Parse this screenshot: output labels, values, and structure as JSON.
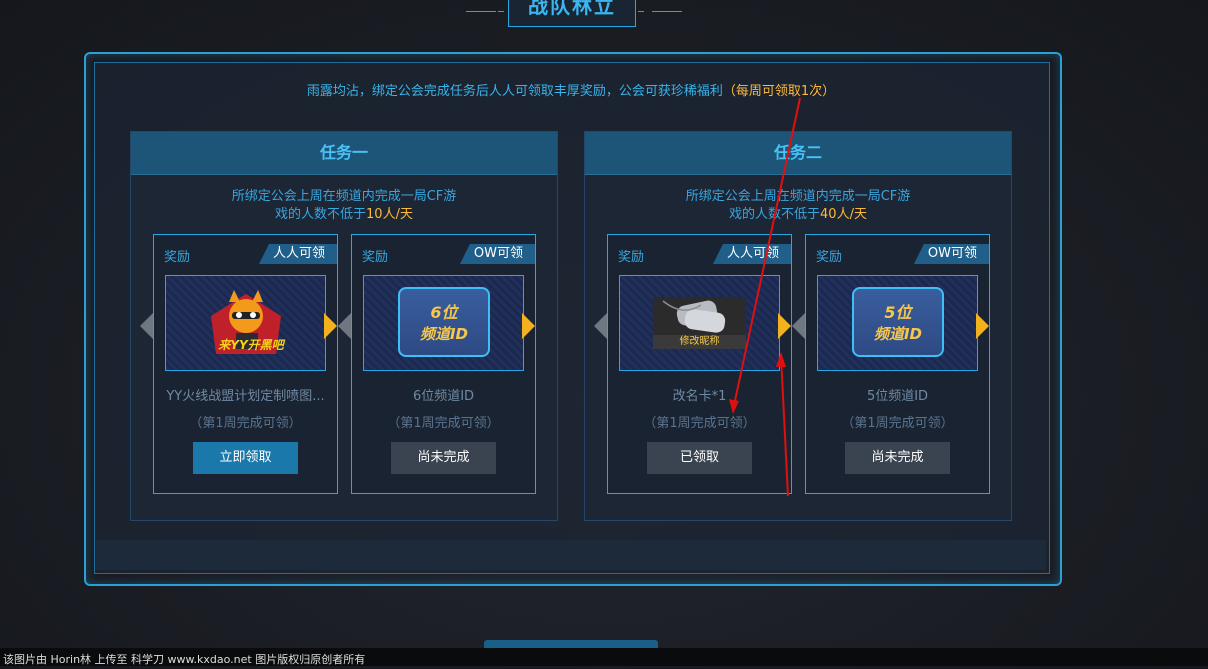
{
  "header": {
    "title": "战队林立"
  },
  "intro": {
    "text": "雨露均沾，绑定公会完成任务后人人可领取丰厚奖励，公会可获珍稀福利",
    "highlight": "（每周可领取1次）"
  },
  "tasks": [
    {
      "title": "任务一",
      "desc_line1": "所绑定公会上周在频道内完成一局CF游",
      "desc_line2": "戏的人数不低于",
      "desc_highlight": "10人/天",
      "cards": [
        {
          "label": "奖励",
          "badge": "人人可领",
          "name": "YY火线战盟计划定制喷图...",
          "art_text": "来YY开黑吧",
          "week": "（第1周完成可领）",
          "button": "立即领取"
        },
        {
          "label": "奖励",
          "badge": "OW可领",
          "name": "6位频道ID",
          "id_l1": "6位",
          "id_l2": "频道ID",
          "week": "（第1周完成可领）",
          "button": "尚未完成"
        }
      ]
    },
    {
      "title": "任务二",
      "desc_line1": "所绑定公会上周在频道内完成一局CF游",
      "desc_line2": "戏的人数不低于",
      "desc_highlight": "40人/天",
      "cards": [
        {
          "label": "奖励",
          "badge": "人人可领",
          "name": "改名卡*1",
          "art_text": "修改昵称",
          "week": "（第1周完成可领）",
          "button": "已领取"
        },
        {
          "label": "奖励",
          "badge": "OW可领",
          "name": "5位频道ID",
          "id_l1": "5位",
          "id_l2": "频道ID",
          "week": "（第1周完成可领）",
          "button": "尚未完成"
        }
      ]
    }
  ],
  "footer": {
    "text": "该图片由 Horin林 上传至 科学刀 www.kxdao.net 图片版权归原创者所有"
  },
  "colors": {
    "accent": "#2aa6e0",
    "highlight": "#ffb93a",
    "claim": "#1b78aa",
    "disabled": "#3a4350",
    "annotation": "#e01010"
  }
}
